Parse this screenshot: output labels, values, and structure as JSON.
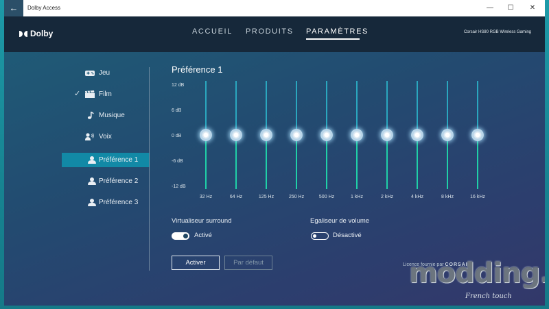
{
  "window": {
    "title": "Dolby Access"
  },
  "titlebar": {
    "back_icon": "back-arrow-icon",
    "minimize": "—",
    "maximize": "☐",
    "close": "✕"
  },
  "header": {
    "logo": "Dolby",
    "nav": [
      "ACCUEIL",
      "PRODUITS",
      "PARAMÈTRES"
    ],
    "active_nav": "PARAMÈTRES",
    "device": "Corsair HS80 RGB Wireless Gaming"
  },
  "sidebar": {
    "items": [
      {
        "label": "Jeu",
        "icon": "gamepad-icon"
      },
      {
        "label": "Film",
        "icon": "clapperboard-icon",
        "checked": true
      },
      {
        "label": "Musique",
        "icon": "music-note-icon"
      },
      {
        "label": "Voix",
        "icon": "voice-icon"
      },
      {
        "label": "Préférence 1",
        "icon": "person-icon",
        "active": true
      },
      {
        "label": "Préférence 2",
        "icon": "person-icon"
      },
      {
        "label": "Préférence 3",
        "icon": "person-icon"
      }
    ]
  },
  "equalizer": {
    "title": "Préférence 1",
    "db_labels": [
      "12 dB",
      "6 dB",
      "0 dB",
      "-6 dB",
      "-12 dB"
    ],
    "db_range": [
      -12,
      12
    ],
    "bands": [
      {
        "freq": "32 Hz",
        "gain_db": 0
      },
      {
        "freq": "64 Hz",
        "gain_db": 0
      },
      {
        "freq": "125 Hz",
        "gain_db": 0
      },
      {
        "freq": "250 Hz",
        "gain_db": 0
      },
      {
        "freq": "500 Hz",
        "gain_db": 0
      },
      {
        "freq": "1 kHz",
        "gain_db": 0
      },
      {
        "freq": "2 kHz",
        "gain_db": 0
      },
      {
        "freq": "4 kHz",
        "gain_db": 0
      },
      {
        "freq": "8 kHz",
        "gain_db": 0
      },
      {
        "freq": "16 kHz",
        "gain_db": 0
      }
    ]
  },
  "options": {
    "surround": {
      "label": "Virtualiseur surround",
      "state": "Activé",
      "on": true
    },
    "volume": {
      "label": "Egaliseur de volume",
      "state": "Désactivé",
      "on": false
    }
  },
  "buttons": {
    "apply": "Activer",
    "default": "Par défaut"
  },
  "licence": {
    "text": "Licence fournie par",
    "brand": "CORSAIR"
  },
  "watermark": {
    "text": "modding.fr",
    "sub": "French touch"
  },
  "colors": {
    "accent": "#1289a6",
    "track": "#2aa7bf",
    "track_active": "#1fd0a8"
  }
}
